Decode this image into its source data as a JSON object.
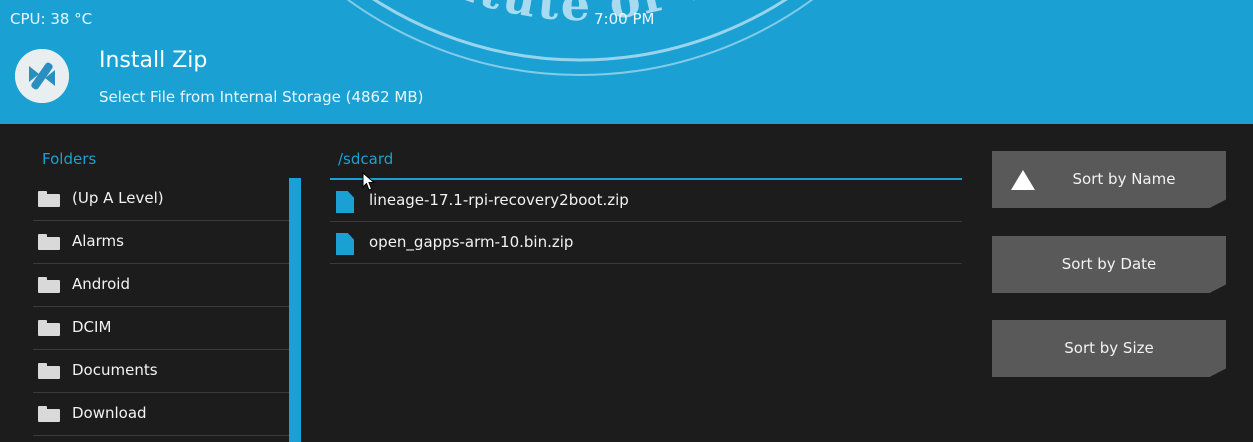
{
  "status_bar": {
    "cpu": "CPU: 38 °C",
    "time": "7:00 PM"
  },
  "header": {
    "title": "Install Zip",
    "subtitle": "Select File from Internal Storage (4862 MB)",
    "logo_icon": "twrp-logo-icon"
  },
  "watermark": {
    "text": "Institute of Tech"
  },
  "folders": {
    "heading": "Folders",
    "items": [
      {
        "label": "(Up A Level)",
        "icon": "folder-icon"
      },
      {
        "label": "Alarms",
        "icon": "folder-icon"
      },
      {
        "label": "Android",
        "icon": "folder-icon"
      },
      {
        "label": "DCIM",
        "icon": "folder-icon"
      },
      {
        "label": "Documents",
        "icon": "folder-icon"
      },
      {
        "label": "Download",
        "icon": "folder-icon"
      }
    ]
  },
  "files": {
    "path": "/sdcard",
    "items": [
      {
        "name": "lineage-17.1-rpi-recovery2boot.zip",
        "icon": "file-icon"
      },
      {
        "name": "open_gapps-arm-10.bin.zip",
        "icon": "file-icon"
      }
    ]
  },
  "sort_buttons": {
    "name": "Sort by Name",
    "date": "Sort by Date",
    "size": "Sort by Size",
    "active_icon": "sort-ascending-icon"
  },
  "colors": {
    "accent": "#1ba0d4",
    "background": "#1c1c1c",
    "button": "#595959",
    "text": "#f2f2f2"
  }
}
